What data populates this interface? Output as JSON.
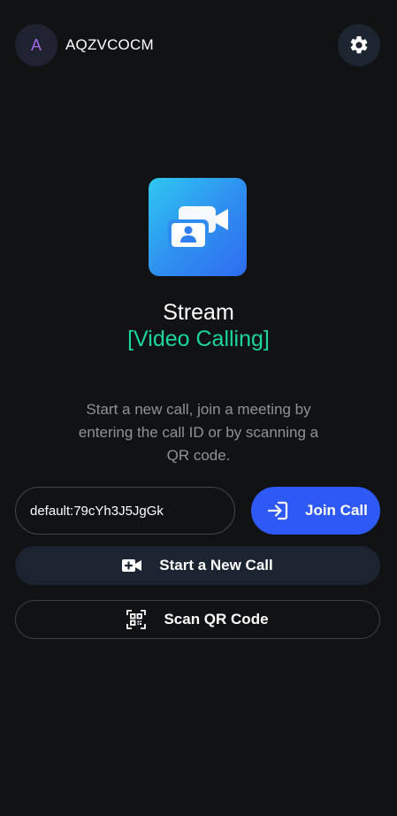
{
  "header": {
    "avatar_initial": "A",
    "username": "AQZVCOCM",
    "settings_icon": "gear-icon"
  },
  "hero": {
    "logo_icon": "video-call-icon",
    "title": "Stream",
    "subtitle": "[Video Calling]",
    "description": "Start a new call, join a meeting by entering the call ID or by scanning a QR code."
  },
  "join": {
    "call_id_value": "default:79cYh3J5JgGk",
    "join_label": "Join Call",
    "join_icon": "login-arrow-icon"
  },
  "actions": {
    "new_call_label": "Start a New Call",
    "new_call_icon": "video-add-icon",
    "scan_label": "Scan QR Code",
    "scan_icon": "qr-code-icon"
  },
  "colors": {
    "background": "#111214",
    "accent_blue": "#2e59f7",
    "accent_green": "#1bd69a",
    "avatar_letter": "#a066e8"
  }
}
